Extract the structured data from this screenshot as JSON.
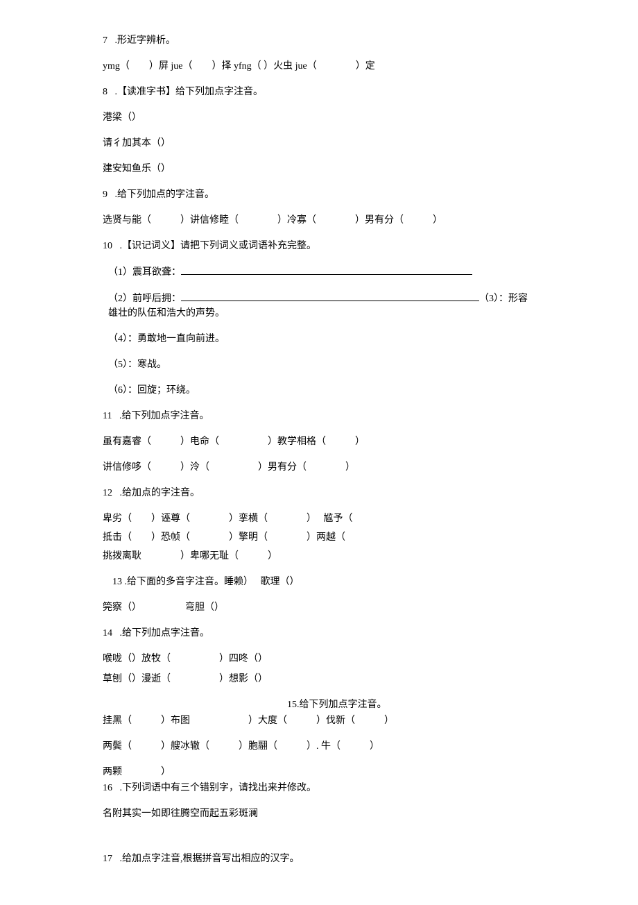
{
  "q7": {
    "num": "7",
    "title": ".形近字辨析。",
    "line": "ymg（　　）屏 jue（　　）择 yfng（ ）火虫 jue（　　　　）定"
  },
  "q8": {
    "num": "8",
    "title": ".【读准字书】给下列加点字注音。",
    "l1": "港梁（）",
    "l2": "请彳加其本（）",
    "l3": "建安知鱼乐（）"
  },
  "q9": {
    "num": "9",
    "title": ".给下列加点的字注音。",
    "l1": "选贤与能（　　　）讲信修睦（　　　　）冷寡（　　　　）男有分（　　　）"
  },
  "q10": {
    "num": "10",
    "title": ".【识记词义】请把下列词义或词语补充完整。",
    "i1": "（1）震耳欲聋：",
    "i2a": "（2）前呼后拥：",
    "i2b": "（3）：形容雄壮的队伍和浩大的声势。",
    "i4": "（4）：勇敢地一直向前进。",
    "i5": "（5）：寒战。",
    "i6": "（6）：回旋；环绕。"
  },
  "q11": {
    "num": "11",
    "title": ".给下列加点字注音。",
    "l1": "虽有嘉睿（　　　）电命（　　　　　）教学相格（　　　）",
    "l2": "讲信修哆（　　　）泠（　　　　　）男有分（　　　　）"
  },
  "q12": {
    "num": "12",
    "title": ".给加点的字注音。",
    "l1": "卑劣（　　）诬尊（　　　　）挛横（　　　　）　 尴予（",
    "l2": "抵击（　　）恐帧（　　　　）擎明（　　　　）两越（",
    "l3": "挑拨离耿　　　　）卑哪无耻（　　　）"
  },
  "q13": {
    "num": "　13",
    "title": ".给下面的多音字注音。睡赖）　 歌理（）",
    "l1": "筦察（）　　　　　弯胆（）"
  },
  "q14": {
    "num": "14",
    "title": ".给下列加点字注音。",
    "l1": "喉咙（）放牧（　　　　　）四咚（）",
    "l2": "草刨（）漫逝（　　　　　）想影（）"
  },
  "q15": {
    "num": "15",
    "title": ".给下列加点字注音。",
    "l1": "　　　　　　　　　　　　　　　　　　　15.给下列加点字注音。",
    "l2": "挂黑（　　　）布图　　　　　　）大度（　　　）伐新（　　　）",
    "l3": "两鬓（　　　）艘冰辙（　　　）胞翮（　　　）. 牛（　　　）",
    "l4": "两颗　　　　）"
  },
  "q16": {
    "num": "16",
    "title": ".下列词语中有三个错别字，请找出来并修改。",
    "l1": "名附其实一如即往腾空而起五彩斑澜"
  },
  "q17": {
    "num": "17",
    "title": ".给加点字注音,根据拼音写出相应的汉字。"
  }
}
